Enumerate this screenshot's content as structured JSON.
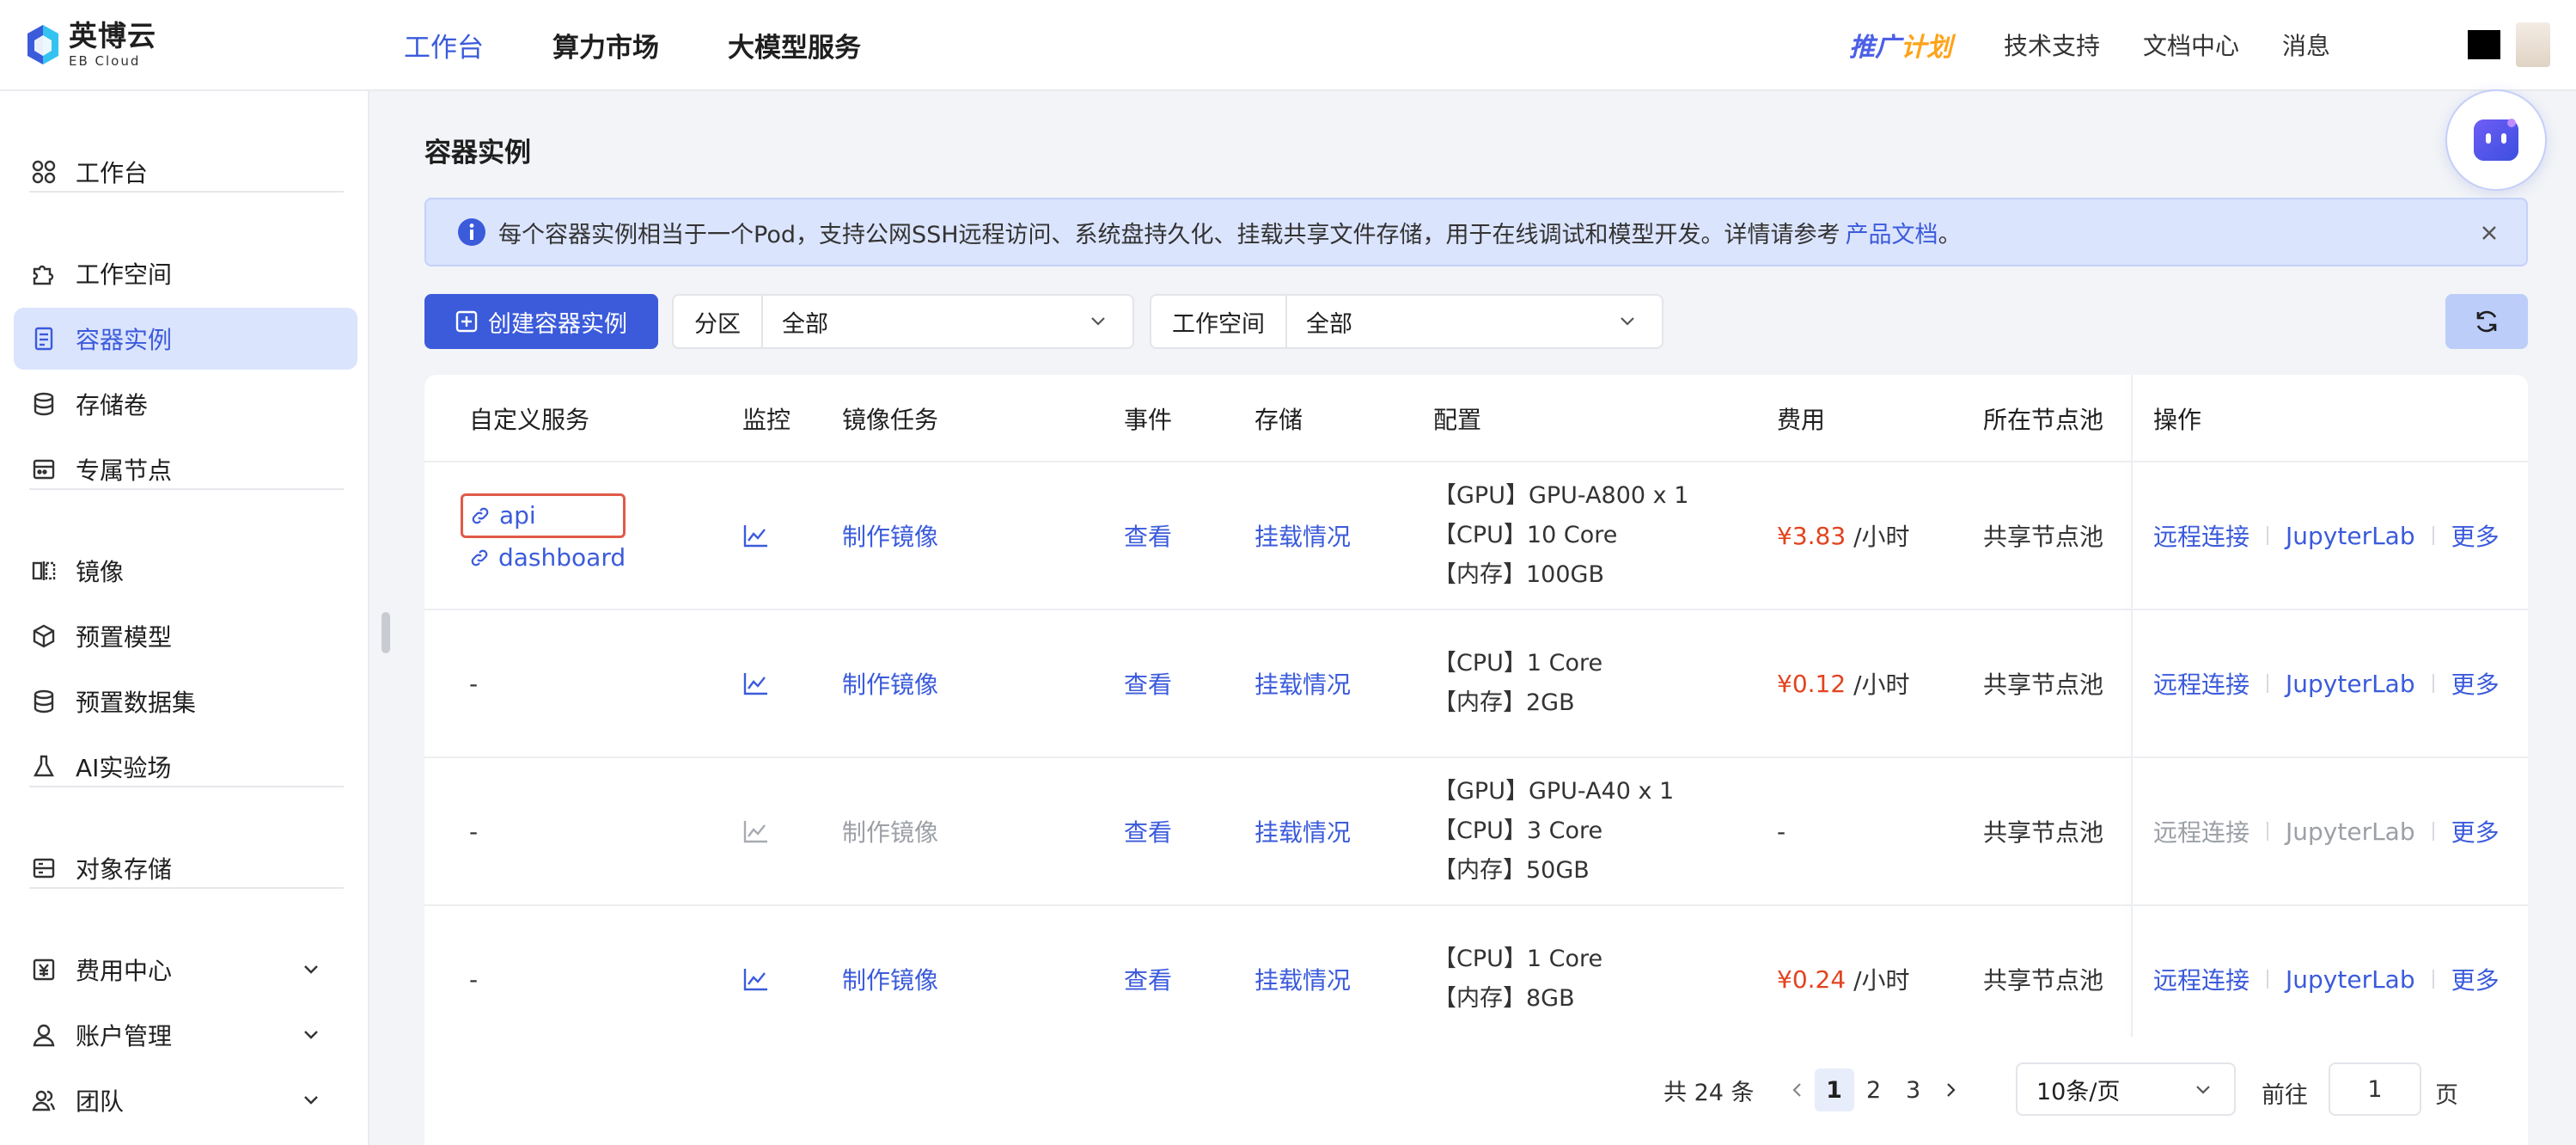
{
  "brand": {
    "name_cn": "英博云",
    "name_en": "EB Cloud"
  },
  "top_nav": {
    "items": [
      "工作台",
      "算力市场",
      "大模型服务"
    ]
  },
  "right_nav": {
    "promo_a": "推广",
    "promo_b": "计划",
    "links": [
      "技术支持",
      "文档中心",
      "消息"
    ]
  },
  "sidebar": {
    "items": [
      {
        "label": "工作台",
        "icon": "grid-icon"
      },
      {
        "label": "工作空间",
        "icon": "puzzle-icon"
      },
      {
        "label": "容器实例",
        "icon": "document-icon",
        "active": true
      },
      {
        "label": "存储卷",
        "icon": "database-icon"
      },
      {
        "label": "专属节点",
        "icon": "server-icon"
      },
      {
        "label": "镜像",
        "icon": "mirror-icon"
      },
      {
        "label": "预置模型",
        "icon": "cube-icon"
      },
      {
        "label": "预置数据集",
        "icon": "database-icon"
      },
      {
        "label": "AI实验场",
        "icon": "flask-icon"
      },
      {
        "label": "对象存储",
        "icon": "storage-icon"
      },
      {
        "label": "费用中心",
        "icon": "yen-icon"
      },
      {
        "label": "账户管理",
        "icon": "user-icon"
      },
      {
        "label": "团队",
        "icon": "team-icon"
      }
    ]
  },
  "page": {
    "title": "容器实例",
    "alert_text": "每个容器实例相当于一个Pod，支持公网SSH远程访问、系统盘持久化、挂载共享文件存储，用于在线调试和模型开发。详情请参考",
    "alert_link": "产品文档",
    "alert_end": "。"
  },
  "toolbar": {
    "create_label": "创建容器实例",
    "filters": [
      {
        "label": "分区",
        "value": "全部"
      },
      {
        "label": "工作空间",
        "value": "全部"
      }
    ]
  },
  "table": {
    "columns": [
      "自定义服务",
      "监控",
      "镜像任务",
      "事件",
      "存储",
      "配置",
      "费用",
      "所在节点池",
      "操作"
    ],
    "rows": [
      {
        "services": [
          "api",
          "dashboard"
        ],
        "image_task": "制作镜像",
        "image_task_enabled": true,
        "event": "查看",
        "storage": "挂载情况",
        "config": [
          "【GPU】GPU-A800 x 1",
          "【CPU】10 Core",
          "【内存】100GB"
        ],
        "price": "¥3.83",
        "price_unit": "/小时",
        "pool": "共享节点池",
        "ops": [
          "远程连接",
          "JupyterLab",
          "更多"
        ],
        "ops_enabled": true
      },
      {
        "services_text": "-",
        "image_task": "制作镜像",
        "image_task_enabled": true,
        "event": "查看",
        "storage": "挂载情况",
        "config": [
          "【CPU】1 Core",
          "【内存】2GB"
        ],
        "price": "¥0.12",
        "price_unit": "/小时",
        "pool": "共享节点池",
        "ops": [
          "远程连接",
          "JupyterLab",
          "更多"
        ],
        "ops_enabled": true
      },
      {
        "services_text": "-",
        "image_task": "制作镜像",
        "image_task_enabled": false,
        "event": "查看",
        "storage": "挂载情况",
        "config": [
          "【GPU】GPU-A40 x 1",
          "【CPU】3 Core",
          "【内存】50GB"
        ],
        "price_text": "-",
        "pool": "共享节点池",
        "ops": [
          "远程连接",
          "JupyterLab",
          "更多"
        ],
        "ops_enabled": false
      },
      {
        "services_text": "-",
        "image_task": "制作镜像",
        "image_task_enabled": true,
        "event": "查看",
        "storage": "挂载情况",
        "config": [
          "【CPU】1 Core",
          "【内存】8GB"
        ],
        "price": "¥0.24",
        "price_unit": "/小时",
        "pool": "共享节点池",
        "ops": [
          "远程连接",
          "JupyterLab",
          "更多"
        ],
        "ops_enabled": true
      }
    ]
  },
  "pagination": {
    "total": "共 24 条",
    "pages": [
      "1",
      "2",
      "3"
    ],
    "current": "1",
    "page_size": "10条/页",
    "goto_label": "前往",
    "goto_value": "1",
    "page_suffix": "页"
  },
  "colors": {
    "accent": "#3b5bdb",
    "price": "#e2431e",
    "active_bg": "#dbe4fd"
  }
}
